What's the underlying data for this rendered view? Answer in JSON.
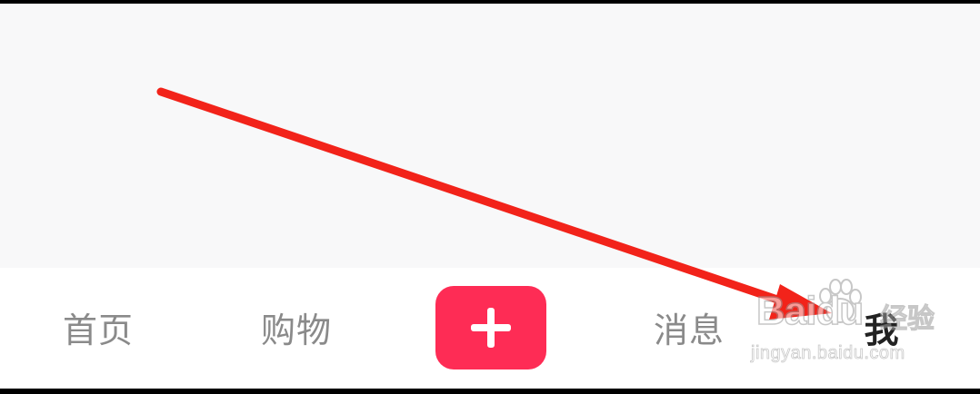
{
  "tabbar": {
    "home_label": "首页",
    "shop_label": "购物",
    "add_icon": "plus-icon",
    "message_label": "消息",
    "me_label": "我"
  },
  "colors": {
    "accent": "#fe2c55",
    "arrow": "#f2231a",
    "tab_text": "#8a8a8a",
    "tab_active_text": "#222222",
    "background": "#f8f8f9"
  },
  "watermark": {
    "logo": "Baidu",
    "cn": "经验",
    "url": "jingyan.baidu.com"
  }
}
